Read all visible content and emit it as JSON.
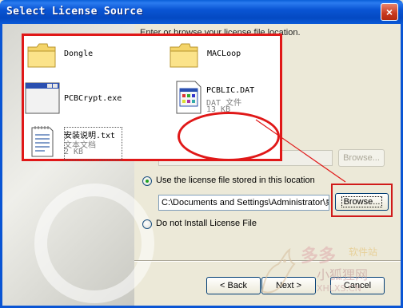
{
  "window": {
    "title": "Select License Source",
    "close_glyph": "×"
  },
  "intro_text": "Enter or browse your license file location.",
  "disabled_browse_label": "Browse...",
  "options": [
    {
      "label": "Use the license file stored in this location",
      "selected": true
    },
    {
      "label": "Do not Install License File",
      "selected": false
    }
  ],
  "path_value": "C:\\Documents and Settings\\Administrator\\桌",
  "browse_label": "Browse...",
  "buttons": {
    "back": "< Back",
    "next": "Next >",
    "cancel": "Cancel"
  },
  "files": [
    {
      "name": "Dongle",
      "icon": "folder-icon"
    },
    {
      "name": "MACLoop",
      "icon": "folder-icon"
    },
    {
      "name": "PCBCrypt.exe",
      "icon": "application-window-icon"
    },
    {
      "name": "PCBLIC.DAT",
      "type": "DAT 文件",
      "size": "13 KB",
      "icon": "dat-file-icon"
    },
    {
      "name": "安装说明.txt",
      "type": "文本文档",
      "size": "2 KB",
      "icon": "text-document-icon"
    }
  ],
  "watermark": {
    "line1": "多多",
    "line2": "软件站",
    "line3": "小狐狸网",
    "line4": "XHLXS.CN"
  },
  "colors": {
    "titlebar": "#0a55d4",
    "annotation_red": "#e01818",
    "dialog_bg": "#ece9d8"
  }
}
